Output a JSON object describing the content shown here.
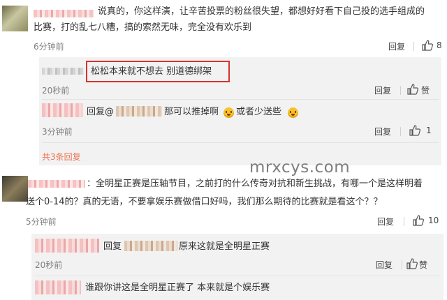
{
  "watermark": "mrxcys.com",
  "comments": [
    {
      "text_line1": "说真的，你这样演，让辛苦投票的粉丝很失望，都想好好看下自己投的选手组成的",
      "text_line2": "比赛，打的乱七八糟，搞的索然无味，完全没有欢乐到",
      "time": "6分钟前",
      "reply_label": "回复",
      "likes": "8",
      "replies": [
        {
          "text": "松松本来就不想去 别道德绑架",
          "time": "20秒前",
          "reply_label": "回复",
          "likes": "赞"
        },
        {
          "prefix": "回复@",
          "middle": "那可以推掉啊",
          "suffix": "或者少送些",
          "time": "3分钟前",
          "reply_label": "回复",
          "likes": "1"
        }
      ],
      "more_replies": "共3条回复"
    },
    {
      "text_line1": "：全明星正赛是压轴节目，之前打的什么传奇对抗和新生挑战，有哪一个是这样明着",
      "text_line2": "送个0-14的？真的无语，不要拿娱乐赛做借口好吗，我们那么期待的比赛就是看这个？？",
      "time": "5分钟前",
      "reply_label": "回复",
      "likes": "10",
      "replies": [
        {
          "prefix": "回复",
          "middle": "原来这就是全明星正赛",
          "time": "20秒前",
          "reply_label": "回复",
          "likes": "赞"
        },
        {
          "text": "谁跟你讲这是全明星正赛了 本来就是个娱乐赛"
        }
      ]
    }
  ],
  "colors": {
    "link": "#eb7350",
    "highlight": "#d9302c",
    "emoji": "#f7c12a"
  },
  "icons": [
    "thumbs-up-icon",
    "smile-emoji-icon"
  ]
}
